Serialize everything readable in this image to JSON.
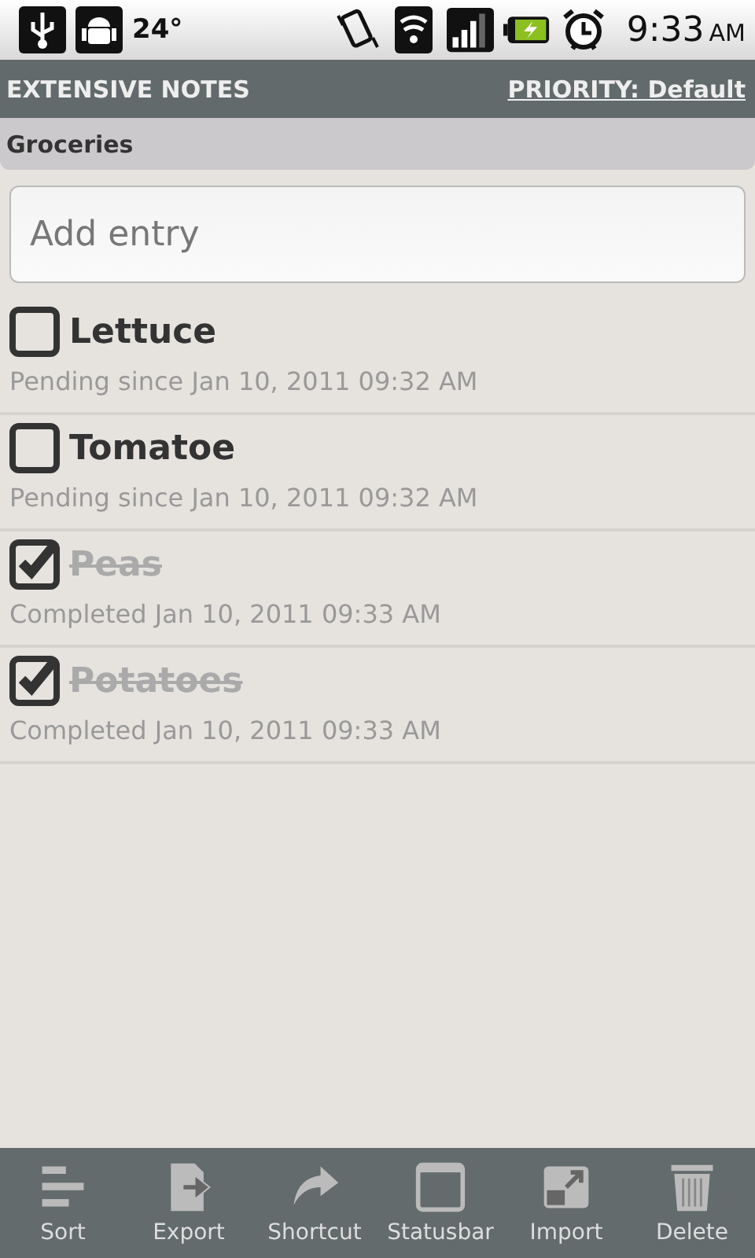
{
  "status_bar": {
    "temperature": "24°",
    "time": "9:33",
    "ampm": "AM"
  },
  "title_bar": {
    "title": "EXTENSIVE NOTES",
    "priority_link": "PRIORITY: Default"
  },
  "list_header": "Groceries",
  "entry_field": {
    "placeholder": "Add entry"
  },
  "items": [
    {
      "name": "Lettuce",
      "status": "Pending since Jan 10, 2011 09:32 AM",
      "checked": false
    },
    {
      "name": "Tomatoe",
      "status": "Pending since Jan 10, 2011 09:32 AM",
      "checked": false
    },
    {
      "name": "Peas",
      "status": "Completed Jan 10, 2011 09:33 AM",
      "checked": true
    },
    {
      "name": "Potatoes",
      "status": "Completed Jan 10, 2011 09:33 AM",
      "checked": true
    }
  ],
  "menu": [
    {
      "kind": "sort",
      "label": "Sort"
    },
    {
      "kind": "export",
      "label": "Export"
    },
    {
      "kind": "shortcut",
      "label": "Shortcut"
    },
    {
      "kind": "statusbar",
      "label": "Statusbar"
    },
    {
      "kind": "import",
      "label": "Import"
    },
    {
      "kind": "delete",
      "label": "Delete"
    }
  ]
}
